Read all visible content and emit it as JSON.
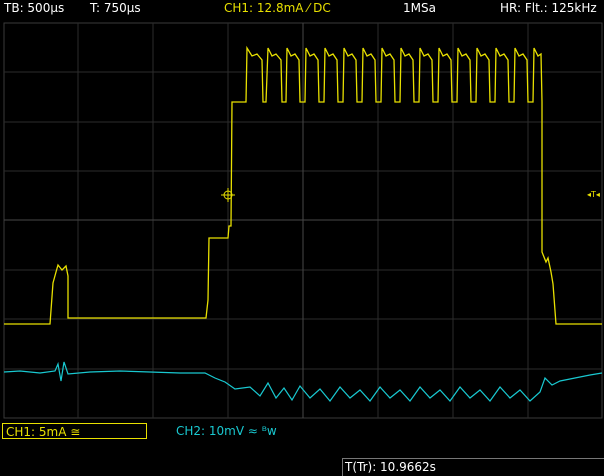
{
  "header": {
    "timebase": "TB: 500µs",
    "trigger_time": "T: 750µs",
    "ch1_setting": "CH1: 12.8mA ⁄ DC",
    "sample_rate": "1MSa",
    "hr_filter": "HR: Flt.: 125kHz"
  },
  "channels": {
    "ch1": "CH1: 5mA ≅",
    "ch2": "CH2: 10mV ≈ ᴮᴡ"
  },
  "footer": {
    "trigger_timestamp": "T(Tr): 10.9662s"
  },
  "trigger_indicator": "◂T◂",
  "colors": {
    "ch1": "#e8e000",
    "ch2": "#19c8d0",
    "grid": "#3a3a3a",
    "header_ch1": "#e8e000"
  }
}
